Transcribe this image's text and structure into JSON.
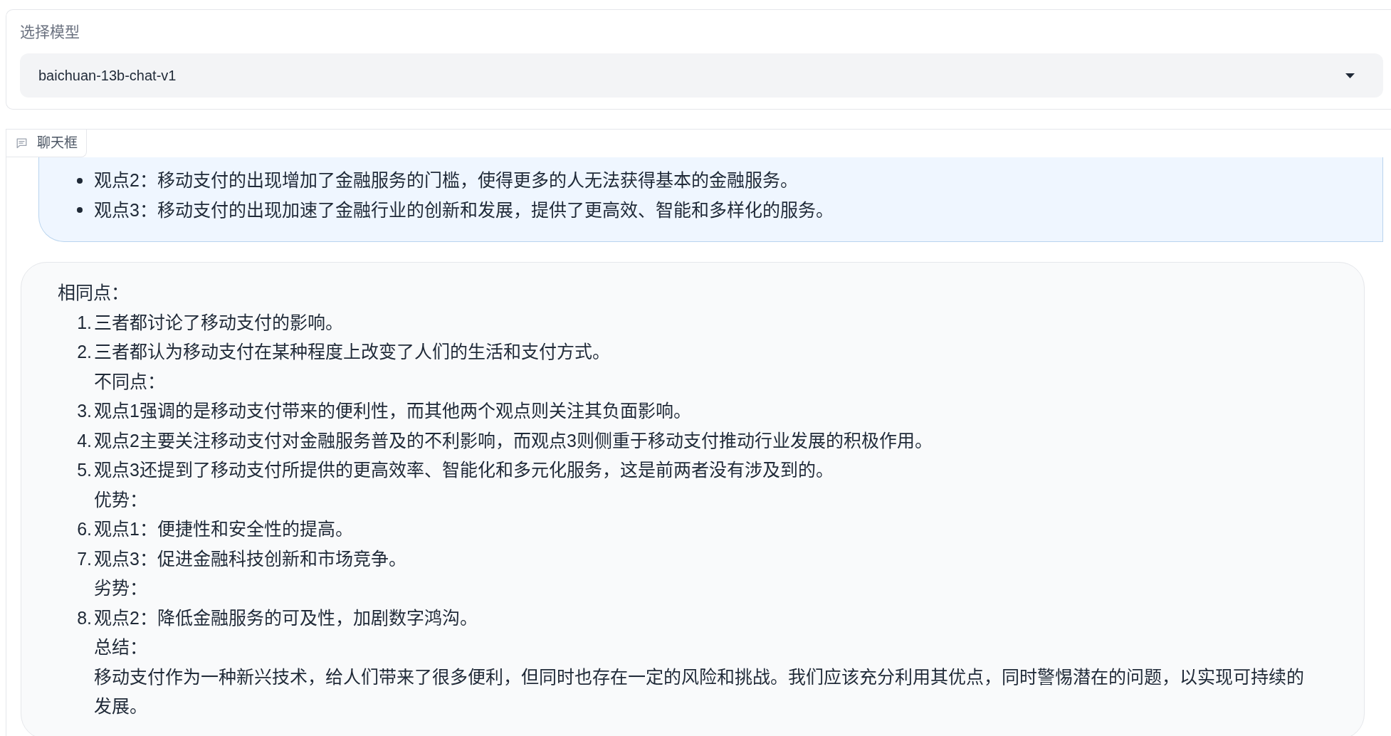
{
  "model_select": {
    "label": "选择模型",
    "value": "baichuan-13b-chat-v1"
  },
  "chat": {
    "label": "聊天框",
    "messages": [
      {
        "kind": "user",
        "blocks": [
          {
            "kind": "bullet",
            "text": "观点2：移动支付的出现增加了金融服务的门槛，使得更多的人无法获得基本的金融服务。"
          },
          {
            "kind": "bullet",
            "text": "观点3：移动支付的出现加速了金融行业的创新和发展，提供了更高效、智能和多样化的服务。"
          }
        ]
      },
      {
        "kind": "bot",
        "blocks": [
          {
            "kind": "paragraph",
            "text": "相同点："
          },
          {
            "kind": "item",
            "marker": "1.",
            "text": "三者都讨论了移动支付的影响。"
          },
          {
            "kind": "item",
            "marker": "2.",
            "text": "三者都认为移动支付在某种程度上改变了人们的生活和支付方式。"
          },
          {
            "kind": "continuation",
            "text": "不同点："
          },
          {
            "kind": "item",
            "marker": "3.",
            "text": "观点1强调的是移动支付带来的便利性，而其他两个观点则关注其负面影响。"
          },
          {
            "kind": "item",
            "marker": "4.",
            "text": "观点2主要关注移动支付对金融服务普及的不利影响，而观点3则侧重于移动支付推动行业发展的积极作用。"
          },
          {
            "kind": "item",
            "marker": "5.",
            "text": "观点3还提到了移动支付所提供的更高效率、智能化和多元化服务，这是前两者没有涉及到的。"
          },
          {
            "kind": "continuation",
            "text": "优势："
          },
          {
            "kind": "item",
            "marker": "6.",
            "text": "观点1：便捷性和安全性的提高。"
          },
          {
            "kind": "item",
            "marker": "7.",
            "text": "观点3：促进金融科技创新和市场竞争。"
          },
          {
            "kind": "continuation",
            "text": "劣势："
          },
          {
            "kind": "item",
            "marker": "8.",
            "text": "观点2：降低金融服务的可及性，加剧数字鸿沟。"
          },
          {
            "kind": "continuation",
            "text": "总结："
          },
          {
            "kind": "continuation",
            "text": "移动支付作为一种新兴技术，给人们带来了很多便利，但同时也存在一定的风险和挑战。我们应该充分利用其优点，同时警惕潜在的问题，以实现可持续的发展。"
          }
        ]
      }
    ]
  }
}
